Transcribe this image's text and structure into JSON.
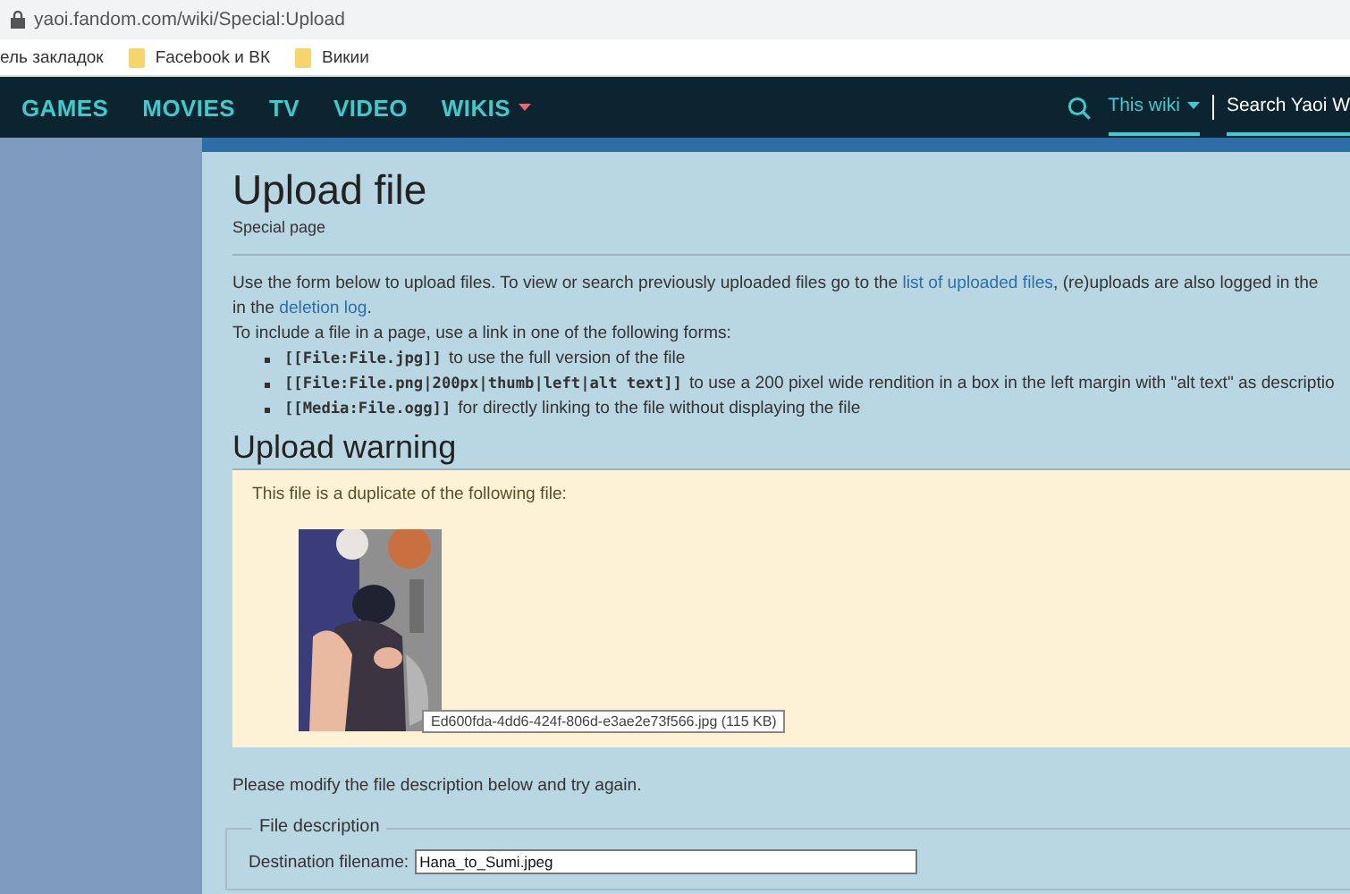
{
  "browser": {
    "url": "yaoi.fandom.com/wiki/Special:Upload",
    "bookmarks": [
      {
        "label": "ель закладок",
        "kind": "text"
      },
      {
        "label": "Facebook и ВК",
        "kind": "folder"
      },
      {
        "label": "Викии",
        "kind": "folder"
      }
    ]
  },
  "nav": {
    "items": [
      {
        "label": "GAMES",
        "dropdown": false
      },
      {
        "label": "MOVIES",
        "dropdown": false
      },
      {
        "label": "TV",
        "dropdown": false
      },
      {
        "label": "VIDEO",
        "dropdown": false
      },
      {
        "label": "WIKIS",
        "dropdown": true
      }
    ],
    "search_scope": "This wiki",
    "search_placeholder": "Search Yaoi W"
  },
  "page": {
    "title": "Upload file",
    "subtitle": "Special page",
    "intro": [
      [
        {
          "text": "Use the form below to upload files. To view or search previously uploaded files go to the ",
          "kind": "text"
        },
        {
          "text": "list of uploaded files",
          "kind": "link"
        },
        {
          "text": ", (re)uploads are also logged in the",
          "kind": "text"
        }
      ],
      [
        {
          "text": "in the ",
          "kind": "text"
        },
        {
          "text": "deletion log",
          "kind": "link"
        },
        {
          "text": ".",
          "kind": "text"
        }
      ],
      [
        {
          "text": "To include a file in a page, use a link in one of the following forms:",
          "kind": "text"
        }
      ]
    ],
    "forms": [
      {
        "code": "[[File:File.jpg]]",
        "text": "to use the full version of the file"
      },
      {
        "code": "[[File:File.png|200px|thumb|left|alt text]]",
        "text": "to use a 200 pixel wide rendition in a box in the left margin with \"alt text\" as descriptio"
      },
      {
        "code": "[[Media:File.ogg]]",
        "text": "for directly linking to the file without displaying the file"
      }
    ],
    "warning": {
      "heading": "Upload warning",
      "message": "This file is a duplicate of the following file:",
      "tooltip": "Ed600fda-4dd6-424f-806d-e3ae2e73f566.jpg (115 KB)"
    },
    "retry": "Please modify the file description below and try again.",
    "fieldset": {
      "legend": "File description",
      "field_label": "Destination filename:",
      "field_value": "Hana_to_Sumi.jpeg"
    }
  }
}
